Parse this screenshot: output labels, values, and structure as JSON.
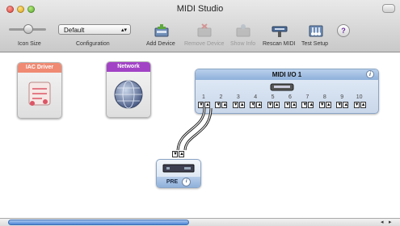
{
  "window": {
    "title": "MIDI Studio"
  },
  "toolbar": {
    "icon_size_label": "Icon Size",
    "configuration_label": "Configuration",
    "configuration_value": "Default",
    "add_device_label": "Add Device",
    "remove_device_label": "Remove Device",
    "show_info_label": "Show Info",
    "rescan_midi_label": "Rescan MIDI",
    "test_setup_label": "Test Setup",
    "help_glyph": "?"
  },
  "devices": {
    "iac_driver": {
      "label": "IAC Driver",
      "color": "#f08a73"
    },
    "network": {
      "label": "Network",
      "color": "#a243c6"
    },
    "midi_io": {
      "label": "MIDI I/O 1",
      "color": "#9ebde4",
      "ports": [
        "1",
        "2",
        "3",
        "4",
        "5",
        "6",
        "7",
        "8",
        "9",
        "10"
      ]
    },
    "pre": {
      "label": "PRE"
    }
  },
  "colors": {
    "scroll_thumb": "#4d86d6",
    "info_accent": "#3a5a88"
  }
}
